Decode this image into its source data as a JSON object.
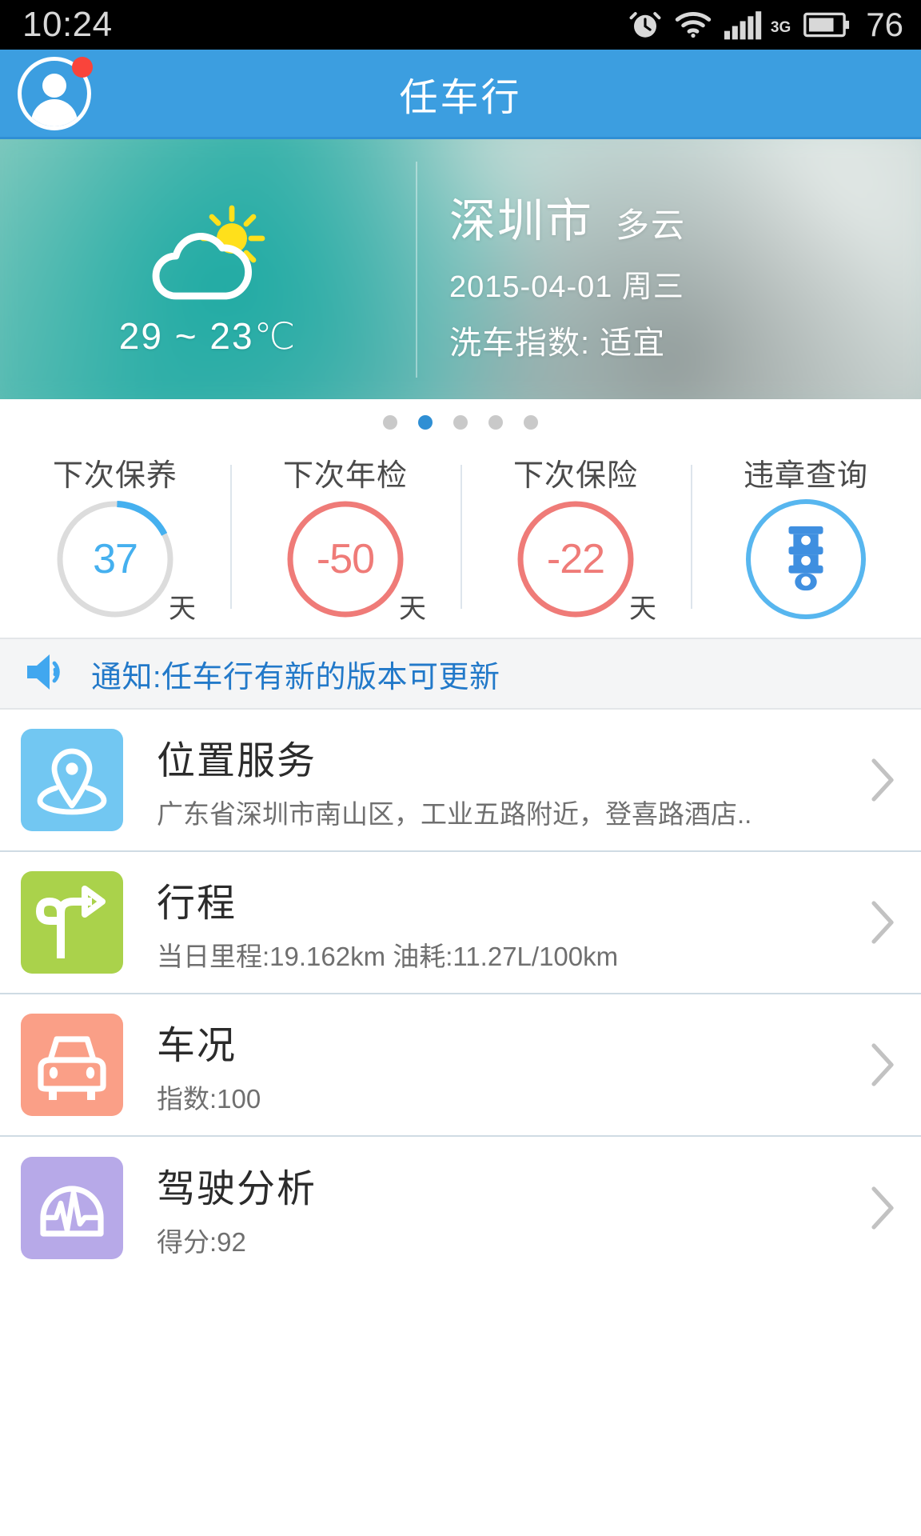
{
  "status_bar": {
    "time": "10:24",
    "network": "3G",
    "battery": "76",
    "icons": [
      "alarm-icon",
      "wifi-icon",
      "signal-icon",
      "battery-icon"
    ]
  },
  "app_bar": {
    "title": "任车行",
    "avatar_icon": "user-avatar-icon",
    "has_badge": true
  },
  "weather": {
    "city": "深圳市",
    "condition": "多云",
    "date": "2015-04-01 周三",
    "wash_index": "洗车指数: 适宜",
    "temperature": "29 ~ 23℃",
    "icon": "partly-cloudy-icon"
  },
  "pager": {
    "count": 5,
    "active_index": 1
  },
  "stats": [
    {
      "label": "下次保养",
      "value": "37",
      "unit": "天",
      "color": "#45b0ef",
      "ring_color": "#45b0ef",
      "track_color": "#dcdcdc",
      "progress": 0.17,
      "kind": "ring"
    },
    {
      "label": "下次年检",
      "value": "-50",
      "unit": "天",
      "color": "#ef7b78",
      "ring_color": "#ef7b78",
      "track_color": "#ef7b78",
      "progress": 1,
      "kind": "ring"
    },
    {
      "label": "下次保险",
      "value": "-22",
      "unit": "天",
      "color": "#ef7b78",
      "ring_color": "#ef7b78",
      "track_color": "#ef7b78",
      "progress": 1,
      "kind": "ring"
    },
    {
      "label": "违章查询",
      "value": "",
      "unit": "",
      "color": "#3f8fe0",
      "ring_color": "#57b6ef",
      "track_color": "#57b6ef",
      "progress": 1,
      "kind": "icon",
      "icon": "traffic-light-icon"
    }
  ],
  "notification": {
    "icon": "speaker-icon",
    "text": "通知:任车行有新的版本可更新",
    "color": "#2279c9"
  },
  "list": [
    {
      "title": "位置服务",
      "subtitle": "广东省深圳市南山区，工业五路附近，登喜路酒店..",
      "icon": "location-pin-icon",
      "icon_bg": "#72c7f2"
    },
    {
      "title": "行程",
      "subtitle": "当日里程:19.162km 油耗:11.27L/100km",
      "icon": "turn-right-arrow-icon",
      "icon_bg": "#aad24b"
    },
    {
      "title": "车况",
      "subtitle": "指数:100",
      "icon": "car-front-icon",
      "icon_bg": "#fa9f87"
    },
    {
      "title": "驾驶分析",
      "subtitle": "得分:92",
      "icon": "pulse-wave-icon",
      "icon_bg": "#b7a9e8"
    }
  ],
  "colors": {
    "brand_blue": "#3c9ee0",
    "accent_red": "#ef7b78",
    "accent_blue": "#45b0ef",
    "badge_red": "#f9443b"
  }
}
